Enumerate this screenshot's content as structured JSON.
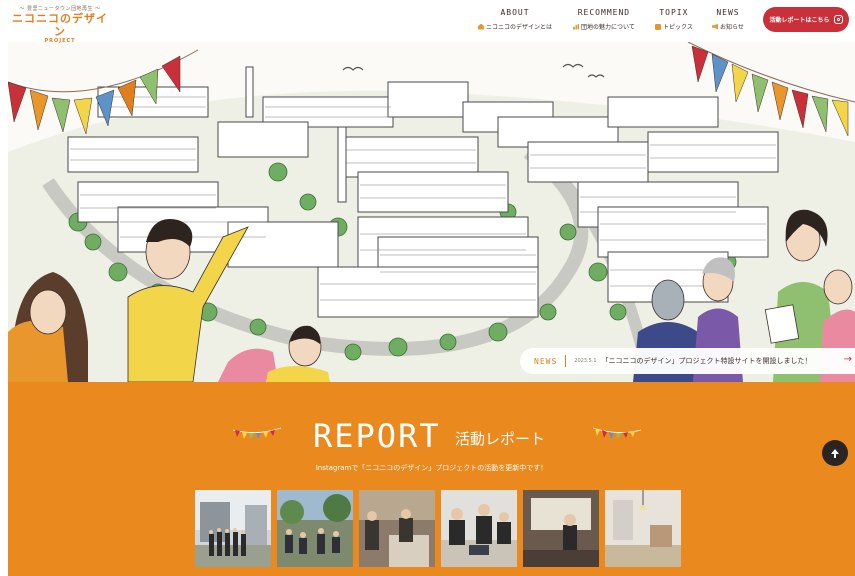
{
  "header": {
    "logo": {
      "tagline": "〜 豊里ニュータウン団地再生 〜",
      "name": "ニコニコのデザイン",
      "sub": "PROJECT"
    },
    "nav": [
      {
        "en": "ABOUT",
        "ja": "ニコニコのデザインとは",
        "icon": "home-icon"
      },
      {
        "en": "RECOMMEND",
        "ja": "団地の魅力について",
        "icon": "chart-icon"
      },
      {
        "en": "TOPIX",
        "ja": "トピックス",
        "icon": "square-icon"
      },
      {
        "en": "NEWS",
        "ja": "お知らせ",
        "icon": "megaphone-icon"
      }
    ],
    "cta_label": "活動レポートはこちら"
  },
  "news": {
    "label": "NEWS",
    "date": "2023.5.1",
    "text": "「ニコニコのデザイン」プロジェクト特設サイトを開設しました！",
    "arrow": "→"
  },
  "report": {
    "title": "REPORT",
    "subtitle": "活動レポート",
    "description": "Instagramで「ニコニコのデザイン」プロジェクトの活動を更新中です！",
    "photos": [
      "instagram-photo-1",
      "instagram-photo-2",
      "instagram-photo-3",
      "instagram-photo-4",
      "instagram-photo-5",
      "instagram-photo-6"
    ]
  },
  "colors": {
    "accent_orange": "#ea8a1e",
    "cta_red": "#c9303a",
    "text_dark": "#3b2e2a"
  }
}
